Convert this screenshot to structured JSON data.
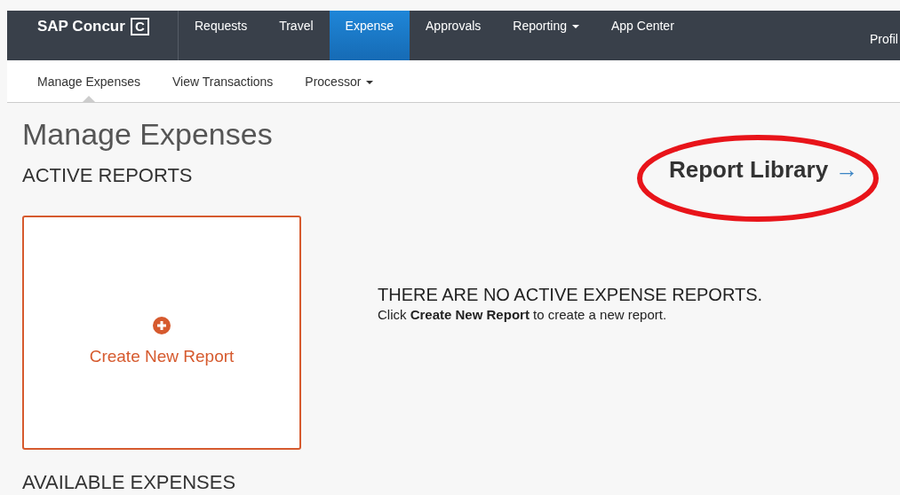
{
  "brand": {
    "name": "SAP Concur",
    "mark": "C"
  },
  "nav": [
    {
      "label": "Requests",
      "selected": false,
      "dropdown": false
    },
    {
      "label": "Travel",
      "selected": false,
      "dropdown": false
    },
    {
      "label": "Expense",
      "selected": true,
      "dropdown": false
    },
    {
      "label": "Approvals",
      "selected": false,
      "dropdown": false
    },
    {
      "label": "Reporting",
      "selected": false,
      "dropdown": true
    },
    {
      "label": "App Center",
      "selected": false,
      "dropdown": false
    }
  ],
  "profile": "Profil",
  "subnav": [
    {
      "label": "Manage Expenses",
      "selected": true,
      "dropdown": false
    },
    {
      "label": "View Transactions",
      "selected": false,
      "dropdown": false
    },
    {
      "label": "Processor",
      "selected": false,
      "dropdown": true
    }
  ],
  "page_title": "Manage Expenses",
  "active_reports": {
    "heading": "ACTIVE REPORTS",
    "create_label": "Create New Report",
    "empty_title": "THERE ARE NO ACTIVE EXPENSE REPORTS.",
    "empty_text": "Click **Create New Report** to create a new report."
  },
  "report_library": {
    "label": "Report Library",
    "arrow": "→",
    "highlighted": true
  },
  "available_expenses": {
    "heading": "AVAILABLE EXPENSES"
  }
}
